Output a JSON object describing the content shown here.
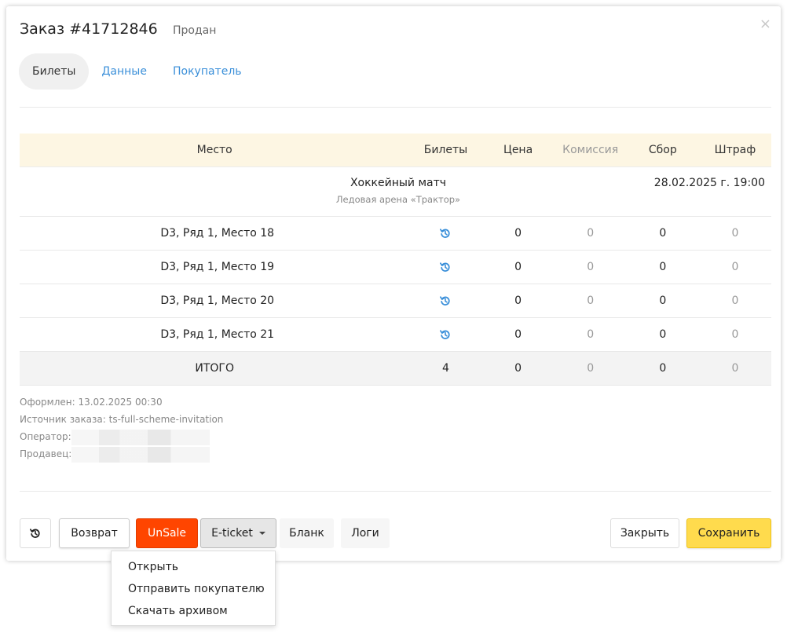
{
  "order": {
    "title": "Заказ #41712846",
    "status": "Продан",
    "close_glyph": "×"
  },
  "tabs": [
    {
      "label": "Билеты",
      "active": true
    },
    {
      "label": "Данные",
      "active": false
    },
    {
      "label": "Покупатель",
      "active": false
    }
  ],
  "table": {
    "headers": {
      "place": "Место",
      "tickets": "Билеты",
      "price": "Цена",
      "commission": "Комиссия",
      "fee": "Сбор",
      "fine": "Штраф"
    },
    "event": {
      "name": "Хоккейный матч",
      "venue": "Ледовая арена «Трактор»",
      "datetime": "28.02.2025 г. 19:00"
    },
    "rows": [
      {
        "place": "D3, Ряд 1, Место 18",
        "price": "0",
        "commission": "0",
        "fee": "0",
        "fine": "0"
      },
      {
        "place": "D3, Ряд 1, Место 19",
        "price": "0",
        "commission": "0",
        "fee": "0",
        "fine": "0"
      },
      {
        "place": "D3, Ряд 1, Место 20",
        "price": "0",
        "commission": "0",
        "fee": "0",
        "fine": "0"
      },
      {
        "place": "D3, Ряд 1, Место 21",
        "price": "0",
        "commission": "0",
        "fee": "0",
        "fine": "0"
      }
    ],
    "total": {
      "label": "ИТОГО",
      "tickets": "4",
      "price": "0",
      "commission": "0",
      "fee": "0",
      "fine": "0"
    }
  },
  "meta": {
    "created": "Оформлен: 13.02.2025 00:30",
    "source": "Источник заказа: ts-full-scheme-invitation",
    "operator_label": "Оператор:",
    "seller_label": "Продавец:"
  },
  "buttons": {
    "return": "Возврат",
    "unsale": "UnSale",
    "eticket": "E-ticket",
    "blank": "Бланк",
    "logs": "Логи",
    "close": "Закрыть",
    "save": "Сохранить"
  },
  "dropdown": {
    "items": [
      "Открыть",
      "Отправить покупателю",
      "Скачать архивом"
    ]
  },
  "colors": {
    "accent_link": "#3a8fd9",
    "unsale": "#ff4500",
    "save": "#ffdb4d",
    "table_header": "#fdf6e3"
  },
  "icons": {
    "refund": "refund-history-icon",
    "caret": "caret-down-icon"
  }
}
